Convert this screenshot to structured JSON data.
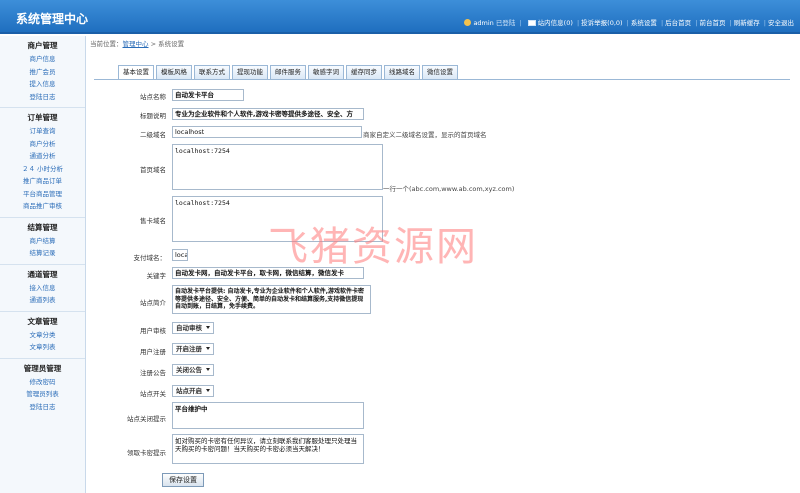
{
  "header": {
    "title": "系统管理中心",
    "user": "admin",
    "logged_in": "已登陆",
    "links": [
      "站内信息(0)",
      "投诉举报(0,0)",
      "系统设置",
      "后台首页",
      "前台首页",
      "刷新缓存",
      "安全退出"
    ]
  },
  "sidebar": {
    "groups": [
      {
        "title": "商户管理",
        "items": [
          "商户信息",
          "推广会员",
          "提入信息",
          "登陆日志"
        ]
      },
      {
        "title": "订单管理",
        "items": [
          "订单查询",
          "商户分析",
          "通道分析",
          "２４ 小时分析",
          "推广商品订单",
          "平台商品管理",
          "商品推广审核"
        ]
      },
      {
        "title": "结算管理",
        "items": [
          "商户结算",
          "结算记录"
        ]
      },
      {
        "title": "通道管理",
        "items": [
          "接入信息",
          "通道列表"
        ]
      },
      {
        "title": "文章管理",
        "items": [
          "文章分类",
          "文章列表"
        ]
      },
      {
        "title": "管理员管理",
        "items": [
          "修改密码",
          "管理员列表",
          "登陆日志"
        ]
      }
    ]
  },
  "breadcrumb": {
    "prefix": "当前位置：",
    "link": "管理中心",
    "sep": " > ",
    "current": "系统设置"
  },
  "tabs": [
    "基本设置",
    "模板风格",
    "联系方式",
    "提现功能",
    "邮件服务",
    "敏感字词",
    "缓存同步",
    "线路域名",
    "微信设置"
  ],
  "form": {
    "site_name": {
      "label": "站点名称",
      "value": "自动发卡平台"
    },
    "title_desc": {
      "label": "标题说明",
      "value": "专业为企业软件和个人软件,游戏卡密等提供多途径、安全、方"
    },
    "subdomain": {
      "label": "二级域名",
      "value": "localhost",
      "hint": "商家自定义二级域名设置，显示的首页域名"
    },
    "home_domain": {
      "label": "首页域名",
      "value": "localhost:7254",
      "hint": "一行一个(abc.com,www.ab.com,xyz.com)"
    },
    "card_domain": {
      "label": "售卡域名",
      "value": "localhost:7254"
    },
    "pay_domain": {
      "label": "支付域名：",
      "value": "loca"
    },
    "keywords": {
      "label": "关键字",
      "value": "自动发卡网，自动发卡平台，取卡网，微信结算，微信发卡"
    },
    "site_intro": {
      "label": "站点简介",
      "value": "自动发卡平台提供: 自动发卡,专业为企业软件和个人软件,游戏软件卡密等提供多途径、安全、方便、简单的自动发卡和结算服务,支持微信提现自动到账，日结算，免手续费。"
    },
    "user_audit": {
      "label": "用户审核",
      "value": "自动审核"
    },
    "user_register": {
      "label": "用户注册",
      "value": "开启注册"
    },
    "register_notice": {
      "label": "注册公告",
      "value": "关闭公告"
    },
    "site_switch": {
      "label": "站点开关",
      "value": "站点开启"
    },
    "close_notice": {
      "label": "站点关闭提示",
      "value": "平台维护中"
    },
    "card_notice": {
      "label": "领取卡密提示",
      "value": "如对购买的卡密有任何异议，请立刻联系我们客服处理只处理当天购买的卡密问题！当天购买的卡密必须当天解决！"
    },
    "save_label": "保存设置"
  },
  "watermark": "飞猪资源网"
}
